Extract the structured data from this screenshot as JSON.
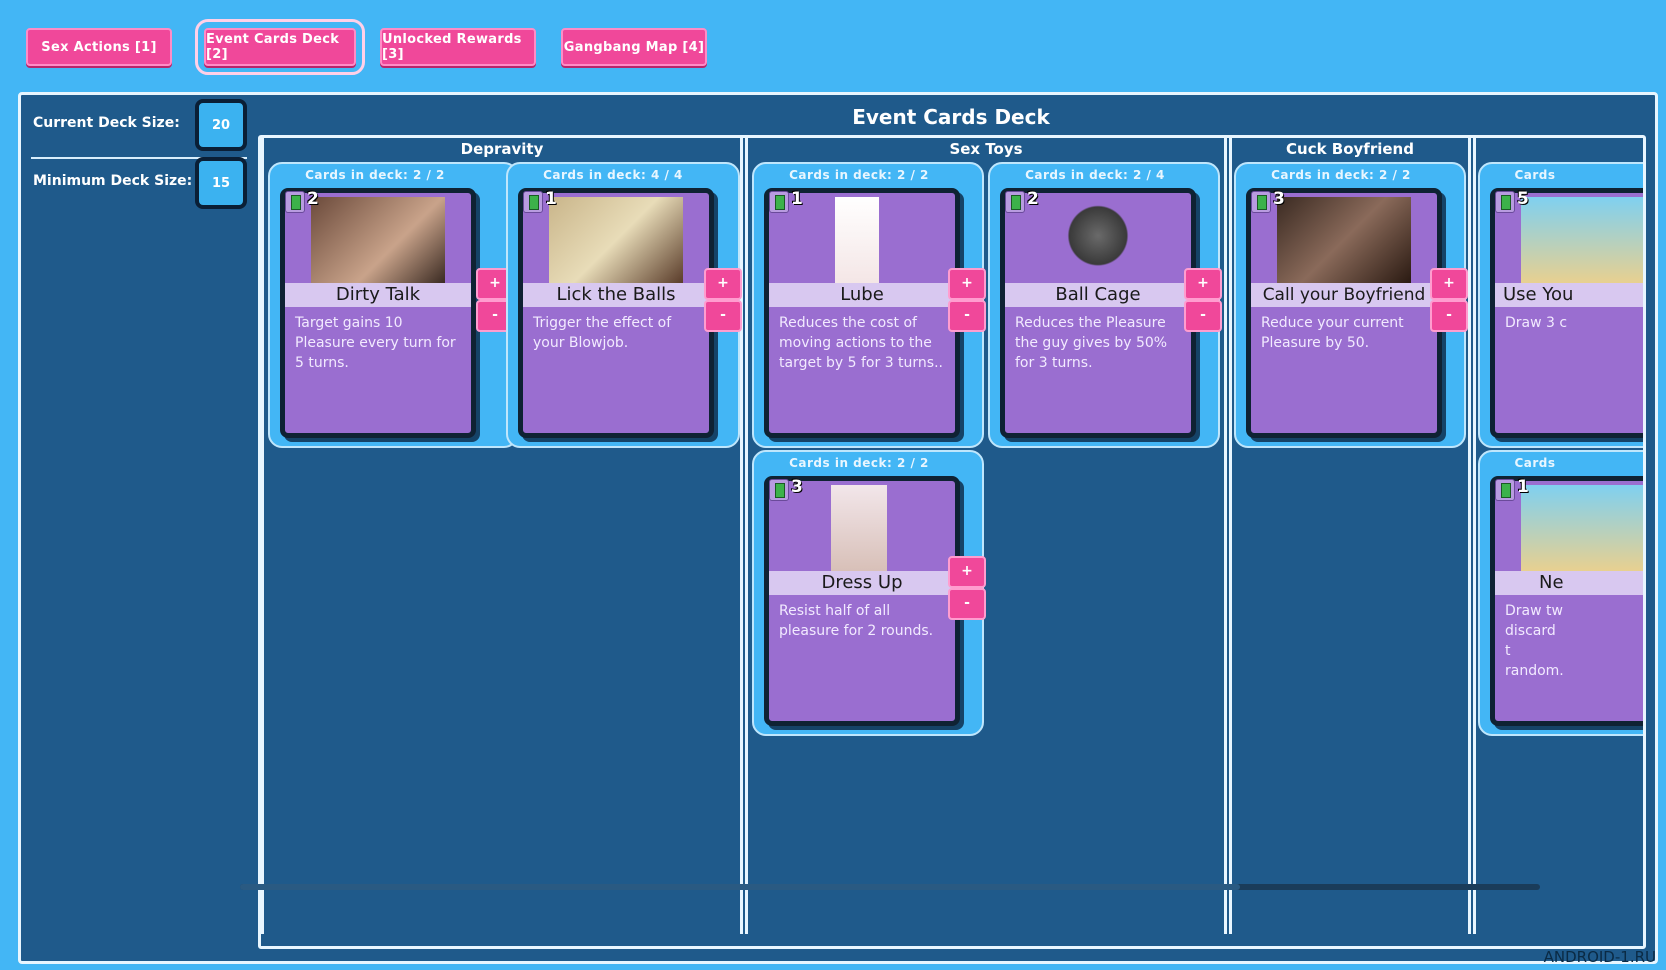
{
  "tabs": [
    {
      "label": "Sex Actions [1]"
    },
    {
      "label": "Event Cards Deck [2]"
    },
    {
      "label": "Unlocked Rewards [3]"
    },
    {
      "label": "Gangbang Map [4]"
    }
  ],
  "sidebar": {
    "current_label": "Current Deck Size:",
    "current_value": "20",
    "minimum_label": "Minimum Deck Size:",
    "minimum_value": "15"
  },
  "deck_title": "Event Cards Deck",
  "categories": [
    {
      "name": "Depravity"
    },
    {
      "name": "Sex Toys"
    },
    {
      "name": "Cuck Boyfriend"
    }
  ],
  "cards": [
    {
      "count": "Cards in deck:  2 / 2",
      "cost": "2",
      "name": "Dirty Talk",
      "desc": "Target gains 10 Pleasure every turn for 5 turns."
    },
    {
      "count": "Cards in deck:  4 / 4",
      "cost": "1",
      "name": "Lick the Balls",
      "desc": "Trigger the effect of your Blowjob."
    },
    {
      "count": "Cards in deck:  2 / 2",
      "cost": "1",
      "name": "Lube",
      "desc": "Reduces the cost of moving actions to the target by 5 for 3 turns.."
    },
    {
      "count": "Cards in deck:  2 / 4",
      "cost": "2",
      "name": "Ball Cage",
      "desc": "Reduces the Pleasure the guy gives by 50% for 3 turns."
    },
    {
      "count": "Cards in deck:  2 / 2",
      "cost": "3",
      "name": "Call your Boyfriend",
      "desc": "Reduce your current Pleasure by 50."
    },
    {
      "count": "Cards in deck:  2 / 2",
      "cost": "3",
      "name": "Dress Up",
      "desc": "Resist half of all pleasure for 2 rounds."
    },
    {
      "count": "Cards",
      "cost": "5",
      "name": "Use You",
      "desc": "Draw 3 c"
    },
    {
      "count": "Cards",
      "cost": "1",
      "name": "Ne",
      "desc": "Draw tw discard t random."
    }
  ],
  "buttons": {
    "plus": "+",
    "minus": "-"
  },
  "watermark": "ANDROID-1.RU"
}
